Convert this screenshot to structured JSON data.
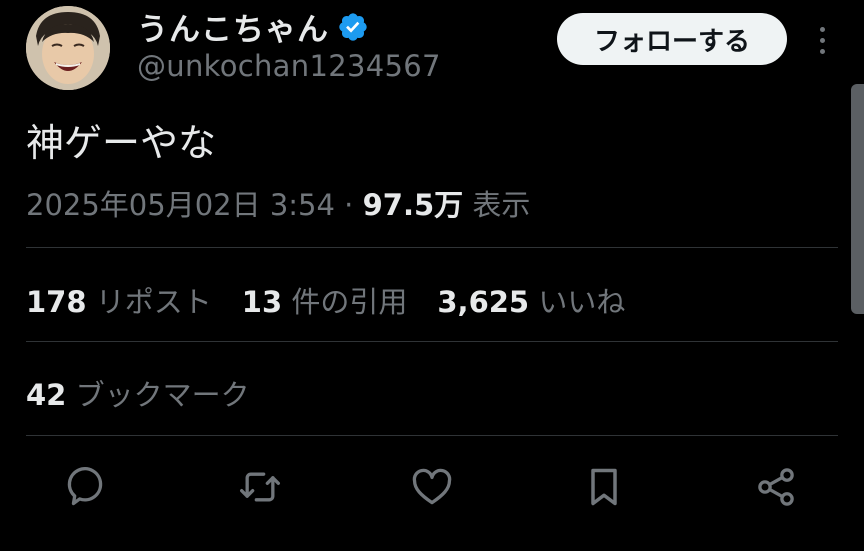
{
  "author": {
    "display_name": "うんこちゃん",
    "handle": "@unkochan1234567",
    "verified": true,
    "avatar_icon": "avatar-photo-icon"
  },
  "header": {
    "follow_label": "フォローする",
    "more_icon": "more-dots-icon"
  },
  "tweet": {
    "text": "神ゲーやな",
    "date": "2025年05月02日 3:54",
    "separator": "·",
    "views_count": "97.5万",
    "views_label": "表示"
  },
  "stats": {
    "reposts": {
      "count": "178",
      "label": "リポスト"
    },
    "quotes": {
      "count": "13",
      "label": "件の引用"
    },
    "likes": {
      "count": "3,625",
      "label": "いいね"
    },
    "bookmarks": {
      "count": "42",
      "label": "ブックマーク"
    }
  },
  "actions": [
    "reply-icon",
    "repost-icon",
    "like-icon",
    "bookmark-icon",
    "share-icon"
  ],
  "colors": {
    "background": "#000000",
    "text": "#e7e9ea",
    "muted": "#71767b",
    "divider": "#2f3336",
    "verified": "#1d9bf0",
    "button_bg": "#eff3f4"
  }
}
